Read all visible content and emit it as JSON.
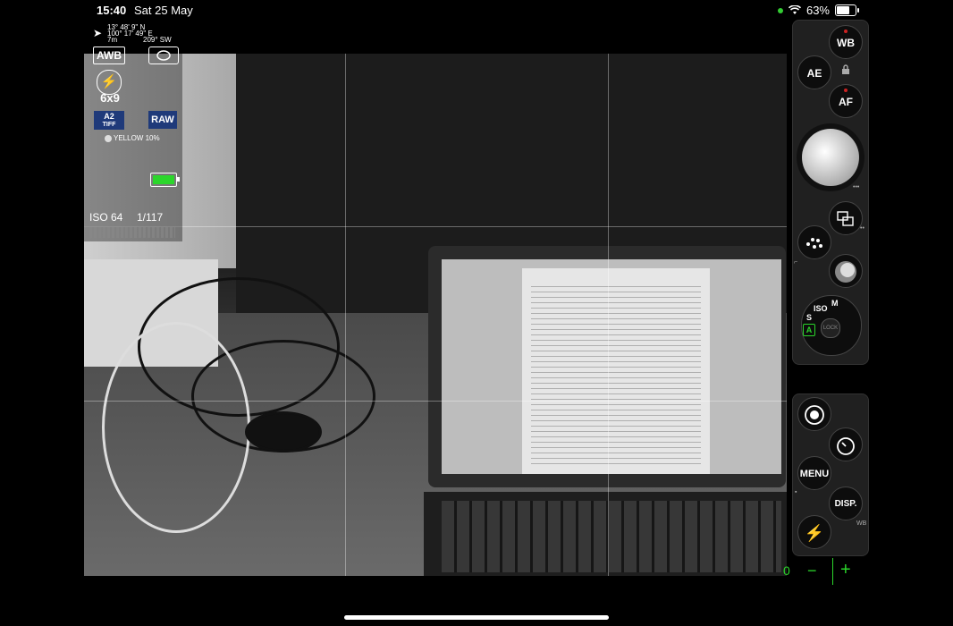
{
  "status_bar": {
    "time": "15:40",
    "date": "Sat 25 May",
    "battery": "63%"
  },
  "gps": {
    "latitude": "13° 48' 9\" N",
    "longitude": "100° 17' 49\" E",
    "altitude": "7m",
    "heading": "209° SW"
  },
  "left_overlay": {
    "white_balance": "AWB",
    "aspect_ratio": "6x9",
    "format_top": "A2",
    "format_bottom": "TIFF",
    "raw": "RAW",
    "filter": "YELLOW 10%",
    "iso": "ISO 64",
    "shutter_speed": "1/117"
  },
  "right_controls": {
    "wb": "WB",
    "ae": "AE",
    "af": "AF",
    "menu": "MENU",
    "disp": "DISP.",
    "wb_small": "WB",
    "mode_a": "A",
    "mode_s": "S",
    "mode_m": "M",
    "mode_iso": "ISO",
    "lock_label": "LOCK"
  },
  "zoom": {
    "value": "0",
    "minus": "−",
    "plus": "+"
  },
  "colors": {
    "accent_green": "#2bd62b",
    "badge_blue": "#1f3a7a",
    "indicator_red": "#cc2222"
  }
}
